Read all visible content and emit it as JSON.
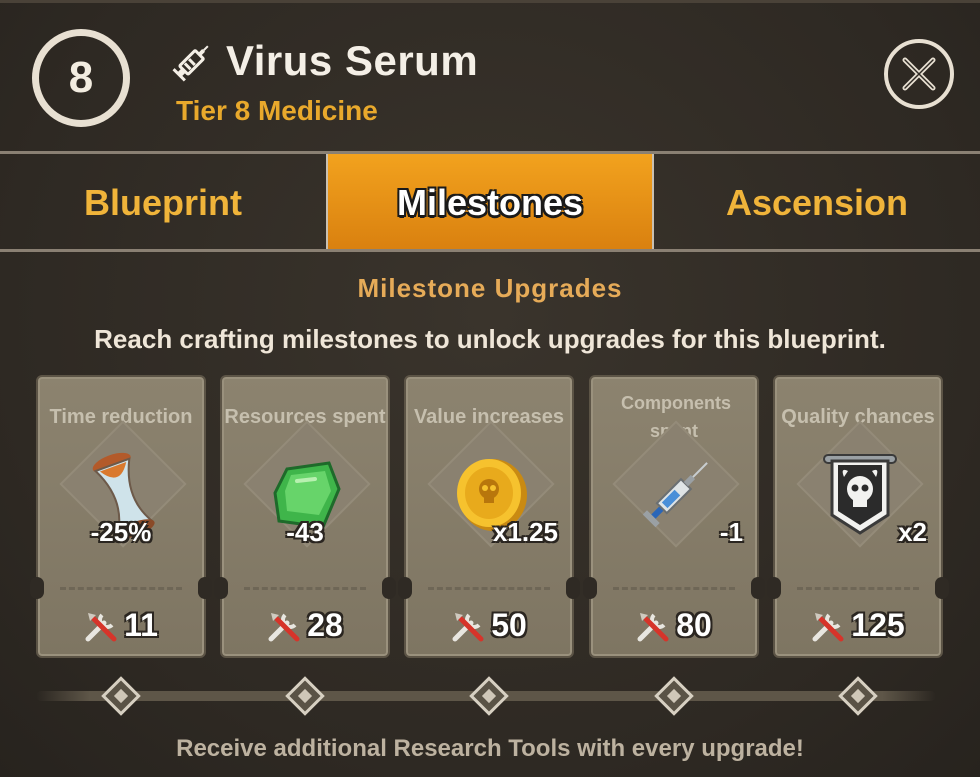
{
  "header": {
    "tier_number": "8",
    "title": "Virus Serum",
    "subtitle": "Tier 8 Medicine",
    "title_icon": "syringe-icon",
    "close_icon": "close-icon"
  },
  "tabs": [
    {
      "label": "Blueprint",
      "active": false
    },
    {
      "label": "Milestones",
      "active": true
    },
    {
      "label": "Ascension",
      "active": false
    }
  ],
  "section": {
    "title": "Milestone Upgrades",
    "description": "Reach crafting milestones to unlock upgrades for this blueprint."
  },
  "milestones": [
    {
      "label": "Time reduction",
      "value": "-25%",
      "cost": "11",
      "icon": "hourglass-icon"
    },
    {
      "label": "Resources spent",
      "value": "-43",
      "cost": "28",
      "icon": "green-gem-icon"
    },
    {
      "label": "Value increases",
      "value": "x1.25",
      "cost": "50",
      "icon": "gold-coin-icon"
    },
    {
      "label": "Components spent",
      "value": "-1",
      "cost": "80",
      "icon": "syringe-icon"
    },
    {
      "label": "Quality chances",
      "value": "x2",
      "cost": "125",
      "icon": "skull-banner-icon"
    }
  ],
  "footer": "Receive additional Research Tools with every upgrade!",
  "colors": {
    "accent": "#e9a92c",
    "tab_active": "#f2a21e",
    "card": "#857c68",
    "background": "#2f2a24"
  }
}
